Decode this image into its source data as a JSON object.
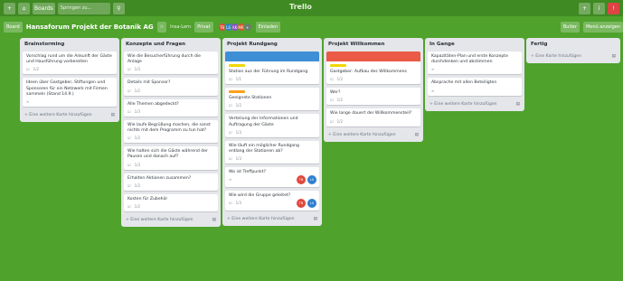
{
  "topbar": {
    "boards_label": "Boards",
    "search_placeholder": "Springen zu...",
    "logo": "Trello",
    "add_label": "+",
    "info_label": "i",
    "bell_label": "!"
  },
  "board": {
    "menu_label": "Board",
    "title": "Hansaforum Projekt der Botanik AG",
    "team_label": "Insa-Lern",
    "visibility_label": "Privat",
    "invite_label": "Einladen",
    "butler_label": "Butler",
    "menu_right_label": "Menü anzeigen",
    "members": [
      {
        "initials": "TB",
        "color": "#e0483d"
      },
      {
        "initials": "LS",
        "color": "#2f7fd1"
      },
      {
        "initials": "AK",
        "color": "#8b4fc7"
      },
      {
        "initials": "MR",
        "color": "#d6562b"
      },
      {
        "initials": "+",
        "color": "#6b7d6f"
      }
    ]
  },
  "colors": {
    "board_bg": "#4fa22c",
    "label_yellow": "#f2d600",
    "label_orange": "#ff9f1a",
    "cover_blue": "#3f8fd6",
    "cover_red": "#eb5a46"
  },
  "lists": [
    {
      "title": "Brainstorming",
      "add_card": "+ Eine weitere Karte hinzufügen",
      "cards": [
        {
          "text": "Vorschlag rund um die Ankunft der Gäste und Hausführung vorbereiten",
          "meta": "1/2"
        },
        {
          "text": "Ideen über Gastgeber, Stiftungen und Sponsoren für ein Netzwerk mit Firmen sammeln (Stand 14.9.)",
          "meta": "≡"
        }
      ]
    },
    {
      "title": "Konzepte und Fragen",
      "add_card": "+ Eine weitere Karte hinzufügen",
      "cards": [
        {
          "text": "Wie die Besucherführung durch die Anlage",
          "meta": "1/3"
        },
        {
          "text": "Details mit Sponsor?",
          "meta": "1/2"
        },
        {
          "text": "Alle Themen abgedeckt?",
          "meta": "1/3"
        },
        {
          "text": "Wie laufe Begrüßung machen, die sonst nichts mit dem Programm zu tun hat?",
          "meta": "1/2"
        },
        {
          "text": "Wie halten sich die Gäste während der Pausen und danach auf?",
          "meta": "1/3"
        },
        {
          "text": "Erhalten Aktionen zusammen?",
          "meta": "1/2"
        },
        {
          "text": "Kosten für Zubehör",
          "meta": "1/2"
        }
      ]
    },
    {
      "title": "Projekt Rundgang",
      "add_card": "+ Eine weitere Karte hinzufügen",
      "cards": [
        {
          "cover": "blue",
          "label": "yellow",
          "text": "Station aus der Führung im Rundgang",
          "meta": "1/1"
        },
        {
          "label": "orange",
          "text": "Geeignete Stationen",
          "meta": "1/2"
        },
        {
          "text": "Verteilung der Informationen und Auftragung der Gäste",
          "meta": "1/3"
        },
        {
          "text": "Wie läuft ein möglicher Rundgang entlang der Stationen ab?",
          "meta": "1/3"
        },
        {
          "text": "Wo ist Treffpunkt?",
          "meta": "≡",
          "members": [
            "TB",
            "LS"
          ]
        },
        {
          "text": "Wie wird die Gruppe geleitet?",
          "meta": "1/3",
          "members": [
            "TB",
            "LS"
          ]
        }
      ]
    },
    {
      "title": "Projekt Willkommen",
      "add_card": "+ Eine weitere Karte hinzufügen",
      "cards": [
        {
          "cover": "red",
          "label": "yellow",
          "text": "Gastgeber: Aufbau des Willkommens",
          "meta": "1/2"
        },
        {
          "text": "Wer?",
          "meta": "1/2"
        },
        {
          "text": "Wie lange dauert der Willkommensteil?",
          "meta": "1/2"
        }
      ]
    },
    {
      "title": "In Gange",
      "add_card": "+ Eine weitere Karte hinzufügen",
      "cards": [
        {
          "text": "Kapazitäten-Plan und erste Konzepte durchdenken und abstimmen",
          "meta": "≡"
        },
        {
          "text": "Absprache mit allen Beteiligten",
          "meta": "≡"
        }
      ]
    },
    {
      "title": "Fertig",
      "add_card": "+ Eine Karte hinzufügen",
      "cards": []
    }
  ]
}
